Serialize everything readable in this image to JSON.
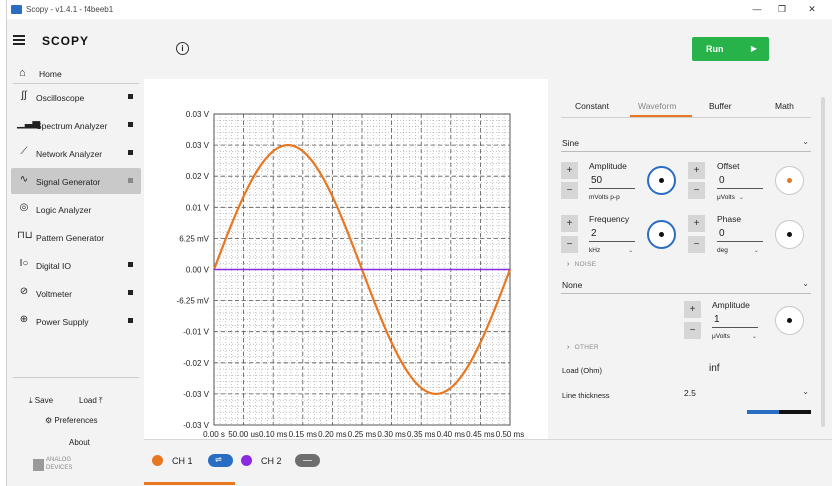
{
  "window": {
    "title": "Scopy - v1.4.1 - f4beeb1",
    "controls": [
      "—",
      "❐",
      "✕"
    ]
  },
  "sidebar": {
    "brand": "SCOPY",
    "home": "Home",
    "tools": [
      {
        "label": "Oscilloscope",
        "icon": "oscilloscope-icon"
      },
      {
        "label": "Spectrum Analyzer",
        "icon": "spectrum-analyzer-icon"
      },
      {
        "label": "Network Analyzer",
        "icon": "network-analyzer-icon"
      },
      {
        "label": "Signal Generator",
        "icon": "signal-generator-icon",
        "active": true
      },
      {
        "label": "Logic Analyzer",
        "icon": "logic-analyzer-icon"
      },
      {
        "label": "Pattern Generator",
        "icon": "pattern-generator-icon"
      },
      {
        "label": "Digital IO",
        "icon": "digital-io-icon"
      },
      {
        "label": "Voltmeter",
        "icon": "voltmeter-icon"
      },
      {
        "label": "Power Supply",
        "icon": "power-supply-icon"
      }
    ],
    "save": "Save",
    "load": "Load",
    "preferences": "Preferences",
    "about": "About",
    "vendor_line1": "ANALOG",
    "vendor_line2": "DEVICES"
  },
  "toolbar": {
    "run_label": "Run",
    "run_color": "#27b34a"
  },
  "settings": {
    "tabs": [
      "Constant",
      "Waveform",
      "Buffer",
      "Math"
    ],
    "active_tab": "Waveform",
    "waveform_type": "Sine",
    "amplitude": {
      "label": "Amplitude",
      "value": "50",
      "unit": "mVolts p-p"
    },
    "offset": {
      "label": "Offset",
      "value": "0",
      "unit": "μVolts"
    },
    "frequency": {
      "label": "Frequency",
      "value": "2",
      "unit": "kHz"
    },
    "phase": {
      "label": "Phase",
      "value": "0",
      "unit": "deg"
    },
    "noise_section": "NOISE",
    "noise_type": "None",
    "noise_amplitude": {
      "label": "Amplitude",
      "value": "1",
      "unit": "μVolts"
    },
    "other_section": "OTHER",
    "load_label": "Load (Ohm)",
    "load_value": "inf",
    "line_thickness_label": "Line thickness",
    "line_thickness_value": "2.5"
  },
  "channels": [
    {
      "label": "CH 1",
      "color": "#e87722",
      "active": true
    },
    {
      "label": "CH 2",
      "color": "#8a2be2",
      "active": false
    }
  ],
  "chart_data": {
    "type": "line",
    "title": "",
    "xlabel": "",
    "ylabel": "",
    "x_ticks": [
      "0.00 s",
      "50.00 us",
      "0.10 ms",
      "0.15 ms",
      "0.20 ms",
      "0.25 ms",
      "0.30 ms",
      "0.35 ms",
      "0.40 ms",
      "0.45 ms",
      "0.50 ms"
    ],
    "y_ticks": [
      "0.03 V",
      "0.03 V",
      "0.02 V",
      "0.01 V",
      "6.25 mV",
      "0.00 V",
      "-6.25 mV",
      "-0.01 V",
      "-0.02 V",
      "-0.03 V",
      "-0.03 V"
    ],
    "xlim": [
      0,
      0.5
    ],
    "ylim": [
      -0.03125,
      0.03125
    ],
    "grid": true,
    "series": [
      {
        "name": "CH 1",
        "color": "#e87722",
        "function": "sine",
        "amplitude_v": 0.025,
        "frequency_khz": 2
      },
      {
        "name": "CH 2",
        "color": "#8a2be2",
        "function": "constant",
        "value_v": 0
      }
    ]
  }
}
